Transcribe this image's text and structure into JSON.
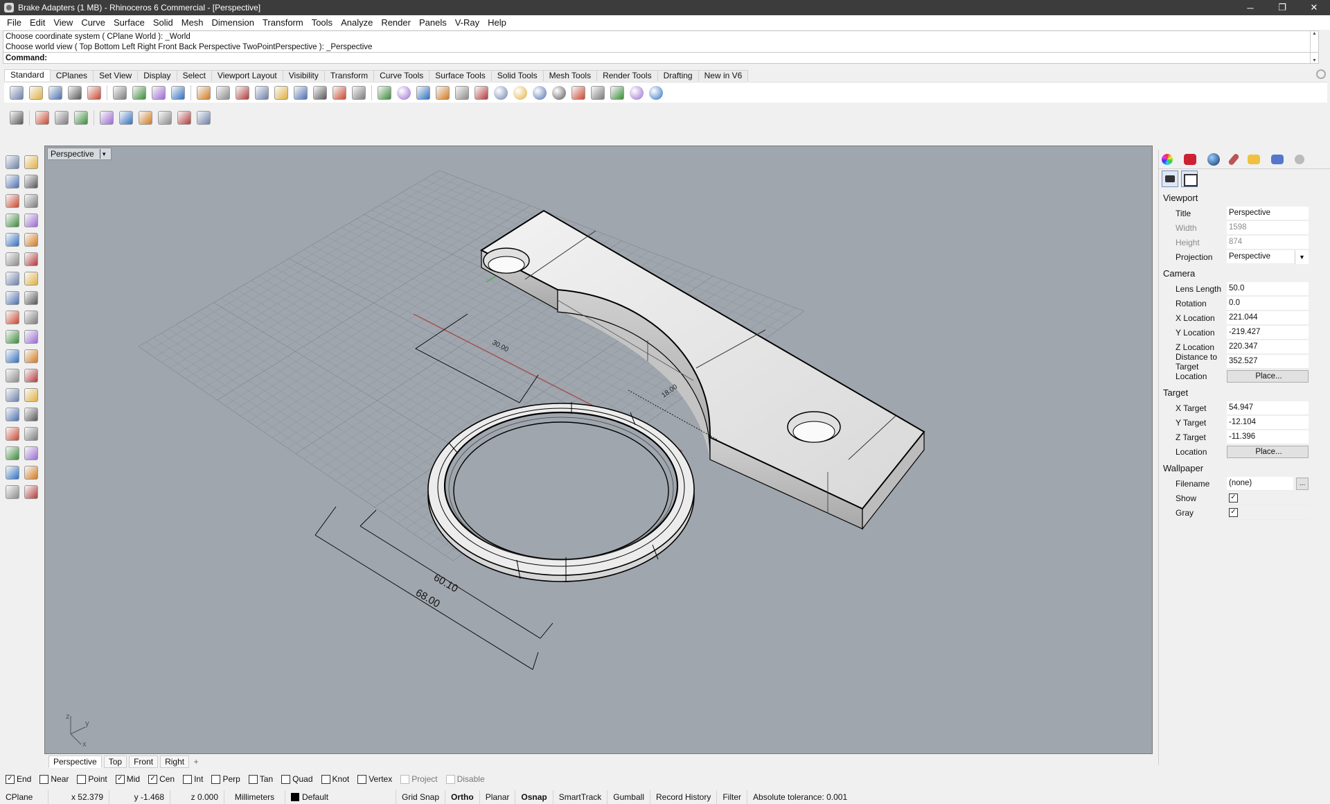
{
  "window": {
    "title": "Brake Adapters (1 MB) - Rhinoceros 6 Commercial - [Perspective]",
    "minimize": "─",
    "restore": "❐",
    "close": "✕"
  },
  "menu": [
    "File",
    "Edit",
    "View",
    "Curve",
    "Surface",
    "Solid",
    "Mesh",
    "Dimension",
    "Transform",
    "Tools",
    "Analyze",
    "Render",
    "Panels",
    "V-Ray",
    "Help"
  ],
  "command": {
    "history": [
      "Choose coordinate system ( CPlane  World ): _World",
      "Choose world view ( Top  Bottom  Left  Right  Front  Back  Perspective  TwoPointPerspective ): _Perspective"
    ],
    "prompt": "Command:",
    "value": ""
  },
  "toolbar_tabs": [
    "Standard",
    "CPlanes",
    "Set View",
    "Display",
    "Select",
    "Viewport Layout",
    "Visibility",
    "Transform",
    "Curve Tools",
    "Surface Tools",
    "Solid Tools",
    "Mesh Tools",
    "Render Tools",
    "Drafting",
    "New in V6"
  ],
  "toolbar1_icons": [
    "new-file-icon",
    "open-icon",
    "save-icon",
    "print-icon",
    "import-icon",
    "cut-icon",
    "copy-icon",
    "paste-icon",
    "undo-icon",
    "pan-hand-icon",
    "move-view-icon",
    "zoom-icon",
    "zoom-window-icon",
    "zoom-extents-icon",
    "zoom-selected-icon",
    "rotate-view-icon",
    "four-views-icon",
    "car-icon",
    "wire-car-icon",
    "target-icon",
    "osnap-icon",
    "bulb-icon",
    "lock-icon",
    "shield-icon",
    "color-wheel-icon",
    "shaded-sphere-icon",
    "rendered-sphere-icon",
    "blue-sphere-icon",
    "flag-icon",
    "gear-options-icon",
    "grid-tools-icon",
    "globe-icon",
    "help-icon"
  ],
  "toolbar2_icons": [
    "check-icon",
    "hand-layers-icon",
    "layer-block-icon",
    "layer-box-icon",
    "helmet-icon",
    "box-outline-icon",
    "ufo-icon",
    "grass-icon",
    "brush-icon",
    "crosshair-plus-icon"
  ],
  "left_tools": [
    [
      "select-arrow-icon",
      "point-icon"
    ],
    [
      "polyline-icon",
      "curve-cv-icon"
    ],
    [
      "circle-icon",
      "ellipse-icon"
    ],
    [
      "polygon-icon",
      "rectangle-icon"
    ],
    [
      "arc-icon",
      "fillet-icon"
    ],
    [
      "surface-corner-icon",
      "loft-icon"
    ],
    [
      "box-solid-icon",
      "sphere-solid-icon"
    ],
    [
      "cylinder-icon",
      "plane-icon"
    ],
    [
      "extrude-icon",
      "sweep-icon"
    ],
    [
      "trim-icon",
      "split-icon"
    ],
    [
      "boolean-icon",
      "join-icon"
    ],
    [
      "offset-icon",
      "blend-icon"
    ],
    [
      "text-icon",
      "scale-icon"
    ],
    [
      "array-icon",
      "rotate-icon"
    ],
    [
      "dimension-icon",
      "measure-icon"
    ],
    [
      "grid-array-icon",
      "block-icon"
    ],
    [
      "analyze-icon",
      "checkmark-icon"
    ],
    [
      "render-mesh-icon",
      "lights-icon"
    ]
  ],
  "viewport": {
    "label": "Perspective",
    "dims": {
      "d30": "30.00",
      "d18": "18.00",
      "d6010": "60.10",
      "d68": "68.00"
    },
    "axes": {
      "z": "z",
      "y": "y",
      "x": "x"
    },
    "tabs": [
      "Perspective",
      "Top",
      "Front",
      "Right"
    ],
    "add": "+"
  },
  "properties": {
    "sections": {
      "viewport": "Viewport",
      "camera": "Camera",
      "target": "Target",
      "wallpaper": "Wallpaper"
    },
    "viewport_rows": [
      {
        "k": "Title",
        "v": "Perspective"
      },
      {
        "k": "Width",
        "v": "1598"
      },
      {
        "k": "Height",
        "v": "874"
      },
      {
        "k": "Projection",
        "v": "Perspective"
      }
    ],
    "camera_rows": [
      {
        "k": "Lens Length",
        "v": "50.0"
      },
      {
        "k": "Rotation",
        "v": "0.0"
      },
      {
        "k": "X Location",
        "v": "221.044"
      },
      {
        "k": "Y Location",
        "v": "-219.427"
      },
      {
        "k": "Z Location",
        "v": "220.347"
      },
      {
        "k": "Distance to Target",
        "v": "352.527"
      },
      {
        "k": "Location",
        "v": "Place..."
      }
    ],
    "target_rows": [
      {
        "k": "X Target",
        "v": "54.947"
      },
      {
        "k": "Y Target",
        "v": "-12.104"
      },
      {
        "k": "Z Target",
        "v": "-11.396"
      },
      {
        "k": "Location",
        "v": "Place..."
      }
    ],
    "wallpaper_rows": [
      {
        "k": "Filename",
        "v": "(none)"
      },
      {
        "k": "Show",
        "v": "✓"
      },
      {
        "k": "Gray",
        "v": "✓"
      }
    ],
    "more": "..."
  },
  "osnaps": [
    {
      "label": "End",
      "checked": true
    },
    {
      "label": "Near",
      "checked": false
    },
    {
      "label": "Point",
      "checked": false
    },
    {
      "label": "Mid",
      "checked": true
    },
    {
      "label": "Cen",
      "checked": true
    },
    {
      "label": "Int",
      "checked": false
    },
    {
      "label": "Perp",
      "checked": false
    },
    {
      "label": "Tan",
      "checked": false
    },
    {
      "label": "Quad",
      "checked": false
    },
    {
      "label": "Knot",
      "checked": false
    },
    {
      "label": "Vertex",
      "checked": false
    },
    {
      "label": "Project",
      "checked": false,
      "disabled": true
    },
    {
      "label": "Disable",
      "checked": false,
      "disabled": true
    }
  ],
  "status": {
    "cplane": "CPlane",
    "x": "x 52.379",
    "y": "y -1.468",
    "z": "z 0.000",
    "units": "Millimeters",
    "layer": "Default",
    "grid_snap": "Grid Snap",
    "ortho": "Ortho",
    "planar": "Planar",
    "osnap": "Osnap",
    "smarttrack": "SmartTrack",
    "gumball": "Gumball",
    "record_history": "Record History",
    "filter": "Filter",
    "tolerance": "Absolute tolerance: 0.001"
  }
}
